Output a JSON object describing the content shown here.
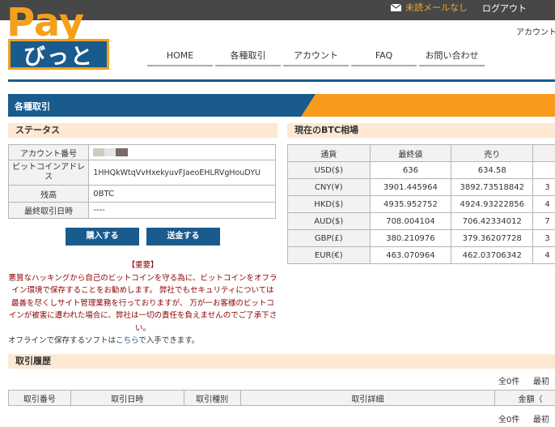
{
  "header": {
    "mail_label": "未読メールなし",
    "logout_label": "ログアウト",
    "account_label": "アカウント",
    "logo_top": "Pay",
    "logo_bottom": "びっと"
  },
  "nav": [
    {
      "label": "HOME"
    },
    {
      "label": "各種取引"
    },
    {
      "label": "アカウント"
    },
    {
      "label": "FAQ"
    },
    {
      "label": "お問い合わせ"
    }
  ],
  "section_title": "各種取引",
  "status": {
    "heading": "ステータス",
    "rows": [
      {
        "label": "アカウント番号",
        "value": ""
      },
      {
        "label": "ビットコインアドレス",
        "value": "1HHQkWtqVvHxekyuvFJaeoEHLRVgHouDYU"
      },
      {
        "label": "残高",
        "value": "0BTC"
      },
      {
        "label": "最終取引日時",
        "value": "----"
      }
    ],
    "buy_label": "購入する",
    "send_label": "送金する"
  },
  "notice": {
    "title": "【重要】",
    "body": "悪質なハッキングから自己のビットコインを守る為に、ビットコインをオフライン環境で保存することをお勧めします。 弊社でもセキュリティについては最善を尽くしサイト管理業務を行っておりますが、 万が一お客様のビットコインが被害に遭われた場合に、弊社は一切の責任を負えませんのでご了承下さい。",
    "offline_prefix": "オフラインで保存するソフトは",
    "offline_link": "こちら",
    "offline_suffix": "で入手できます。"
  },
  "btc": {
    "heading": "現在のBTC相場",
    "columns": [
      "通貨",
      "最終値",
      "売り",
      ""
    ],
    "rows": [
      {
        "currency": "USD($)",
        "last": "636",
        "sell": "634.58",
        "buy": ""
      },
      {
        "currency": "CNY(¥)",
        "last": "3901.445964",
        "sell": "3892.73518842",
        "buy": "3"
      },
      {
        "currency": "HKD($)",
        "last": "4935.952752",
        "sell": "4924.93222856",
        "buy": "4"
      },
      {
        "currency": "AUD($)",
        "last": "708.004104",
        "sell": "706.42334012",
        "buy": "7"
      },
      {
        "currency": "GBP(£)",
        "last": "380.210976",
        "sell": "379.36207728",
        "buy": "3"
      },
      {
        "currency": "EUR(€)",
        "last": "463.070964",
        "sell": "462.03706342",
        "buy": "4"
      }
    ]
  },
  "history": {
    "heading": "取引履歴",
    "count_label": "全0件",
    "first_label": "最初",
    "columns": [
      "取引番号",
      "取引日時",
      "取引種別",
      "取引詳細",
      "金額（"
    ]
  },
  "colors": {
    "brand_blue": "#1a5b8e",
    "brand_orange": "#f89a1c",
    "header_bg": "#474747",
    "mail_text": "#f5a623",
    "notice_text": "#8b0000"
  }
}
